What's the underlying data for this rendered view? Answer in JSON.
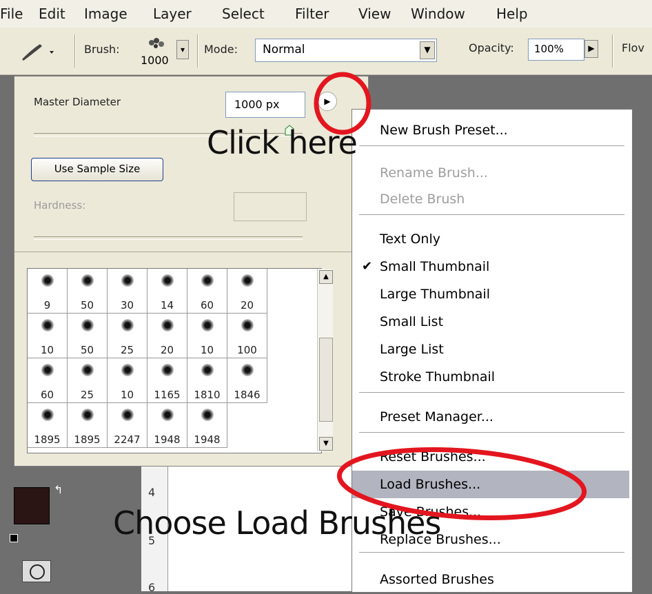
{
  "menubar": [
    "File",
    "Edit",
    "Image",
    "Layer",
    "Select",
    "Filter",
    "View",
    "Window",
    "Help"
  ],
  "options": {
    "brush_label": "Brush:",
    "brush_size": "1000",
    "mode_label": "Mode:",
    "mode_value": "Normal",
    "opacity_label": "Opacity:",
    "opacity_value": "100%",
    "flow_label": "Flov"
  },
  "panel": {
    "master_diameter_label": "Master Diameter",
    "master_diameter_value": "1000 px",
    "use_sample_size": "Use Sample Size",
    "hardness_label": "Hardness:",
    "presets": [
      "9",
      "50",
      "30",
      "14",
      "60",
      "20",
      "10",
      "50",
      "25",
      "20",
      "10",
      "100",
      "60",
      "25",
      "10",
      "1165",
      "1810",
      "1846",
      "1895",
      "1895",
      "2247",
      "1948",
      "1948"
    ]
  },
  "menu": {
    "items": [
      {
        "label": "New Brush Preset...",
        "enabled": true
      },
      {
        "label": "Rename Brush...",
        "enabled": false
      },
      {
        "label": "Delete Brush",
        "enabled": false
      },
      {
        "label": "Text Only",
        "enabled": true
      },
      {
        "label": "Small Thumbnail",
        "enabled": true,
        "checked": true
      },
      {
        "label": "Large Thumbnail",
        "enabled": true
      },
      {
        "label": "Small List",
        "enabled": true
      },
      {
        "label": "Large List",
        "enabled": true
      },
      {
        "label": "Stroke Thumbnail",
        "enabled": true
      },
      {
        "label": "Preset Manager...",
        "enabled": true
      },
      {
        "label": "Reset Brushes...",
        "enabled": true
      },
      {
        "label": "Load Brushes...",
        "enabled": true,
        "highlighted": true
      },
      {
        "label": "Save Brushes...",
        "enabled": true
      },
      {
        "label": "Replace Brushes...",
        "enabled": true
      },
      {
        "label": "Assorted Brushes",
        "enabled": true
      }
    ],
    "checkmark": "✔"
  },
  "ruler": [
    "4",
    "5",
    "6"
  ],
  "annotations": {
    "click_here": "Click  here",
    "choose_load": "Choose  Load  Brushes"
  },
  "colors": {
    "highlight": "#b2b4bf",
    "annotation_circle": "#e3161f",
    "foreground_swatch": "#2b1414"
  }
}
